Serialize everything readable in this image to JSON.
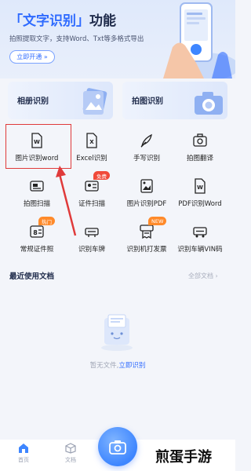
{
  "banner": {
    "title_bracket_text": "「文字识别」",
    "title_suffix": "功能",
    "subtitle": "拍照提取文字，支持Word、Txt等多格式导出",
    "cta_label": "立即开通 »"
  },
  "cards": [
    {
      "label": "相册识别"
    },
    {
      "label": "拍图识别"
    }
  ],
  "grid": [
    {
      "label": "图片识别word",
      "icon": "word-doc-icon"
    },
    {
      "label": "Excel识别",
      "icon": "excel-doc-icon"
    },
    {
      "label": "手写识别",
      "icon": "quill-icon"
    },
    {
      "label": "拍图翻译",
      "icon": "camera-translate-icon"
    },
    {
      "label": "拍图扫描",
      "icon": "scanner-icon"
    },
    {
      "label": "证件扫描",
      "icon": "id-card-icon",
      "badge": "免费"
    },
    {
      "label": "图片识别PDF",
      "icon": "image-pdf-icon"
    },
    {
      "label": "PDF识别Word",
      "icon": "pdf-word-icon"
    },
    {
      "label": "常规证件照",
      "icon": "id-photo-icon",
      "badge": "热门"
    },
    {
      "label": "识别车牌",
      "icon": "license-plate-icon"
    },
    {
      "label": "识别机打发票",
      "icon": "invoice-icon",
      "badge": "NEW"
    },
    {
      "label": "识别车辆VIN码",
      "icon": "vin-icon"
    }
  ],
  "recent": {
    "title": "最近使用文档",
    "all_label": "全部文档 ›",
    "empty_text": "暂无文件,",
    "empty_link": "立即识别"
  },
  "bottom_tabs": [
    {
      "label": "首页"
    },
    {
      "label": "文档"
    }
  ],
  "watermark": "煎蛋手游",
  "colors": {
    "accent": "#2f6bff",
    "highlight": "#e03a3a",
    "badge_red": "#f04a3a",
    "badge_orange": "#ff8a2a"
  }
}
